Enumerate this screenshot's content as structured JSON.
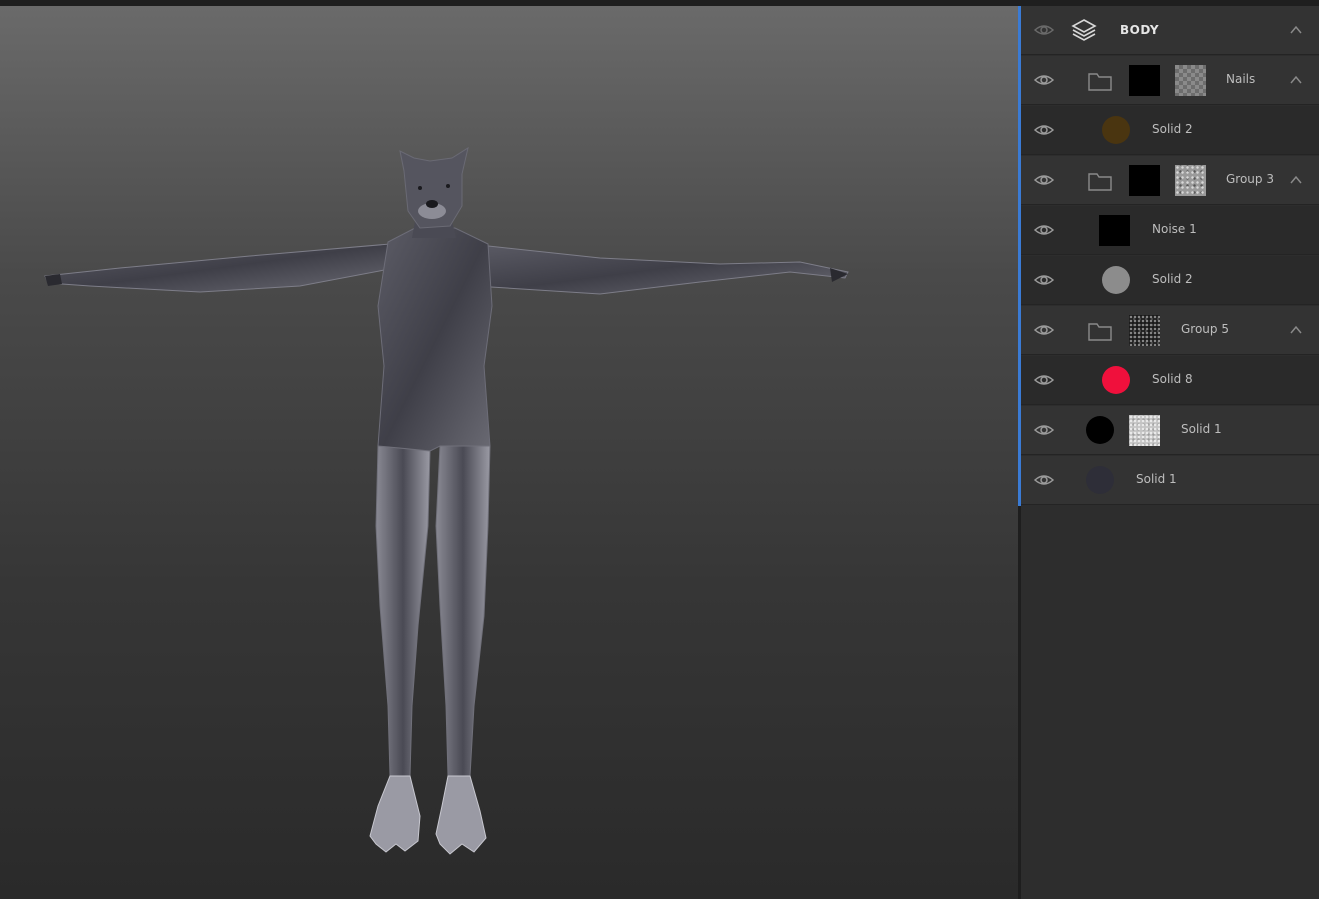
{
  "viewport": {
    "model_icon": "character-model-icon"
  },
  "layers_panel": {
    "title": "BODY",
    "rows": [
      {
        "type": "group",
        "label": "Nails",
        "mask": "#000000",
        "texture": "checker"
      },
      {
        "type": "fill",
        "label": "Solid 2",
        "color": "#4a3510"
      },
      {
        "type": "group",
        "label": "Group 3",
        "mask": "#000000",
        "texture": "speckle"
      },
      {
        "type": "fill",
        "label": "Noise 1",
        "color": "#000000"
      },
      {
        "type": "fill",
        "label": "Solid 2",
        "color": "#8c8c8c"
      },
      {
        "type": "group",
        "label": "Group 5",
        "texture": "dark-noise"
      },
      {
        "type": "fill",
        "label": "Solid 8",
        "color": "#f0103c"
      },
      {
        "type": "fill",
        "label": "Solid 1",
        "color": "#000000",
        "texture": "light-noise"
      },
      {
        "type": "fill",
        "label": "Solid 1",
        "color": "#2e2e38"
      }
    ]
  },
  "colors": {
    "accent": "#3a7bd5",
    "panel_bg": "#2d2d2d"
  }
}
